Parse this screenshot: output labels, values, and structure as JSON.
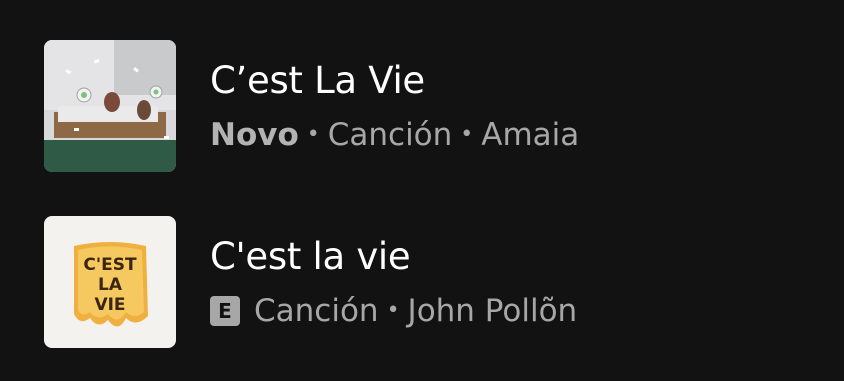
{
  "results": [
    {
      "title": "C’est La Vie",
      "badge": "Novo",
      "type": "Canción",
      "artist": "Amaia",
      "separator": "•",
      "explicit": false,
      "art_icon": "album-art-bedroom-scene"
    },
    {
      "title": "C'est la vie",
      "badge_icon": "explicit-icon",
      "explicit_label": "E",
      "type": "Canción",
      "artist": "John Pollõn",
      "separator": "•",
      "explicit": true,
      "art_icon": "album-art-cest-la-vie-lettering",
      "art_text": [
        "C'EST",
        "LA",
        "VIE"
      ]
    }
  ],
  "colors": {
    "background": "#121212",
    "title": "#ffffff",
    "subtitle": "#a7a7a7"
  }
}
